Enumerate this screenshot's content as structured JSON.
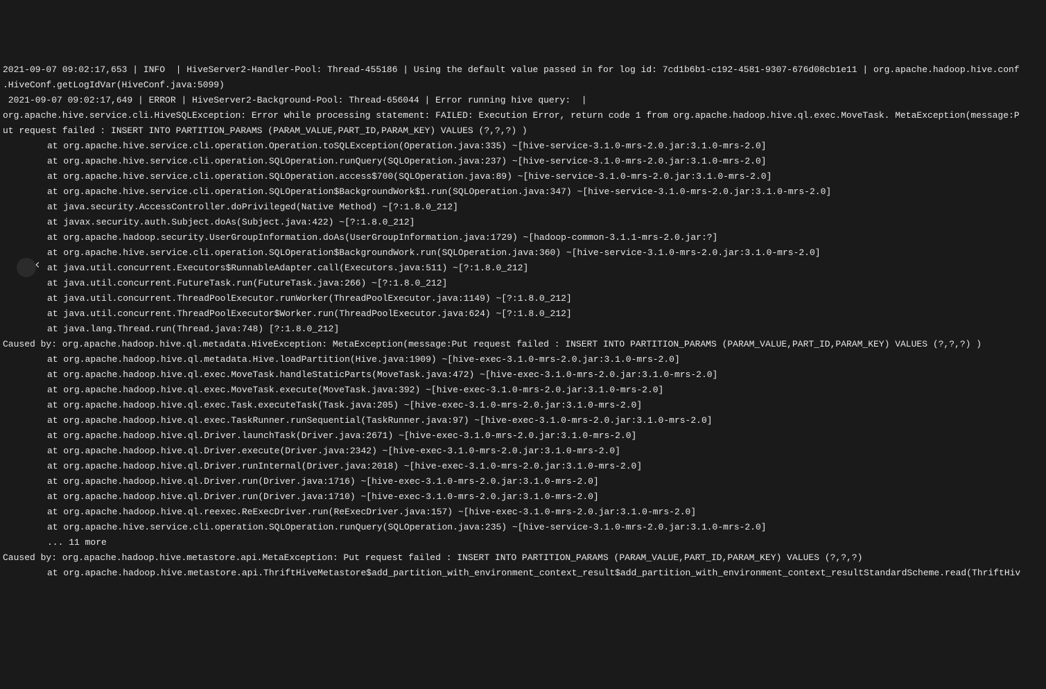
{
  "log": {
    "lines": [
      {
        "indent": false,
        "text": "2021-09-07 09:02:17,653 | INFO  | HiveServer2-Handler-Pool: Thread-455186 | Using the default value passed in for log id: 7cd1b6b1-c192-4581-9307-676d08cb1e11 | org.apache.hadoop.hive.conf"
      },
      {
        "indent": false,
        "text": ".HiveConf.getLogIdVar(HiveConf.java:5099)"
      },
      {
        "indent": false,
        "text": " 2021-09-07 09:02:17,649 | ERROR | HiveServer2-Background-Pool: Thread-656044 | Error running hive query:  |"
      },
      {
        "indent": false,
        "text": "org.apache.hive.service.cli.HiveSQLException: Error while processing statement: FAILED: Execution Error, return code 1 from org.apache.hadoop.hive.ql.exec.MoveTask. MetaException(message:P"
      },
      {
        "indent": false,
        "text": "ut request failed : INSERT INTO PARTITION_PARAMS (PARAM_VALUE,PART_ID,PARAM_KEY) VALUES (?,?,?) )"
      },
      {
        "indent": true,
        "text": "at org.apache.hive.service.cli.operation.Operation.toSQLException(Operation.java:335) ~[hive-service-3.1.0-mrs-2.0.jar:3.1.0-mrs-2.0]"
      },
      {
        "indent": true,
        "text": "at org.apache.hive.service.cli.operation.SQLOperation.runQuery(SQLOperation.java:237) ~[hive-service-3.1.0-mrs-2.0.jar:3.1.0-mrs-2.0]"
      },
      {
        "indent": true,
        "text": "at org.apache.hive.service.cli.operation.SQLOperation.access$700(SQLOperation.java:89) ~[hive-service-3.1.0-mrs-2.0.jar:3.1.0-mrs-2.0]"
      },
      {
        "indent": true,
        "text": "at org.apache.hive.service.cli.operation.SQLOperation$BackgroundWork$1.run(SQLOperation.java:347) ~[hive-service-3.1.0-mrs-2.0.jar:3.1.0-mrs-2.0]"
      },
      {
        "indent": true,
        "text": "at java.security.AccessController.doPrivileged(Native Method) ~[?:1.8.0_212]"
      },
      {
        "indent": true,
        "text": "at javax.security.auth.Subject.doAs(Subject.java:422) ~[?:1.8.0_212]"
      },
      {
        "indent": true,
        "text": "at org.apache.hadoop.security.UserGroupInformation.doAs(UserGroupInformation.java:1729) ~[hadoop-common-3.1.1-mrs-2.0.jar:?]"
      },
      {
        "indent": true,
        "text": "at org.apache.hive.service.cli.operation.SQLOperation$BackgroundWork.run(SQLOperation.java:360) ~[hive-service-3.1.0-mrs-2.0.jar:3.1.0-mrs-2.0]"
      },
      {
        "indent": true,
        "text": "at java.util.concurrent.Executors$RunnableAdapter.call(Executors.java:511) ~[?:1.8.0_212]"
      },
      {
        "indent": true,
        "text": "at java.util.concurrent.FutureTask.run(FutureTask.java:266) ~[?:1.8.0_212]"
      },
      {
        "indent": true,
        "text": "at java.util.concurrent.ThreadPoolExecutor.runWorker(ThreadPoolExecutor.java:1149) ~[?:1.8.0_212]"
      },
      {
        "indent": true,
        "text": "at java.util.concurrent.ThreadPoolExecutor$Worker.run(ThreadPoolExecutor.java:624) ~[?:1.8.0_212]"
      },
      {
        "indent": true,
        "text": "at java.lang.Thread.run(Thread.java:748) [?:1.8.0_212]"
      },
      {
        "indent": false,
        "text": "Caused by: org.apache.hadoop.hive.ql.metadata.HiveException: MetaException(message:Put request failed : INSERT INTO PARTITION_PARAMS (PARAM_VALUE,PART_ID,PARAM_KEY) VALUES (?,?,?) )"
      },
      {
        "indent": true,
        "text": "at org.apache.hadoop.hive.ql.metadata.Hive.loadPartition(Hive.java:1909) ~[hive-exec-3.1.0-mrs-2.0.jar:3.1.0-mrs-2.0]"
      },
      {
        "indent": true,
        "text": "at org.apache.hadoop.hive.ql.exec.MoveTask.handleStaticParts(MoveTask.java:472) ~[hive-exec-3.1.0-mrs-2.0.jar:3.1.0-mrs-2.0]"
      },
      {
        "indent": true,
        "text": "at org.apache.hadoop.hive.ql.exec.MoveTask.execute(MoveTask.java:392) ~[hive-exec-3.1.0-mrs-2.0.jar:3.1.0-mrs-2.0]"
      },
      {
        "indent": true,
        "text": "at org.apache.hadoop.hive.ql.exec.Task.executeTask(Task.java:205) ~[hive-exec-3.1.0-mrs-2.0.jar:3.1.0-mrs-2.0]"
      },
      {
        "indent": true,
        "text": "at org.apache.hadoop.hive.ql.exec.TaskRunner.runSequential(TaskRunner.java:97) ~[hive-exec-3.1.0-mrs-2.0.jar:3.1.0-mrs-2.0]"
      },
      {
        "indent": true,
        "text": "at org.apache.hadoop.hive.ql.Driver.launchTask(Driver.java:2671) ~[hive-exec-3.1.0-mrs-2.0.jar:3.1.0-mrs-2.0]"
      },
      {
        "indent": true,
        "text": "at org.apache.hadoop.hive.ql.Driver.execute(Driver.java:2342) ~[hive-exec-3.1.0-mrs-2.0.jar:3.1.0-mrs-2.0]"
      },
      {
        "indent": true,
        "text": "at org.apache.hadoop.hive.ql.Driver.runInternal(Driver.java:2018) ~[hive-exec-3.1.0-mrs-2.0.jar:3.1.0-mrs-2.0]"
      },
      {
        "indent": true,
        "text": "at org.apache.hadoop.hive.ql.Driver.run(Driver.java:1716) ~[hive-exec-3.1.0-mrs-2.0.jar:3.1.0-mrs-2.0]"
      },
      {
        "indent": true,
        "text": "at org.apache.hadoop.hive.ql.Driver.run(Driver.java:1710) ~[hive-exec-3.1.0-mrs-2.0.jar:3.1.0-mrs-2.0]"
      },
      {
        "indent": true,
        "text": "at org.apache.hadoop.hive.ql.reexec.ReExecDriver.run(ReExecDriver.java:157) ~[hive-exec-3.1.0-mrs-2.0.jar:3.1.0-mrs-2.0]"
      },
      {
        "indent": true,
        "text": "at org.apache.hive.service.cli.operation.SQLOperation.runQuery(SQLOperation.java:235) ~[hive-service-3.1.0-mrs-2.0.jar:3.1.0-mrs-2.0]"
      },
      {
        "indent": true,
        "text": "... 11 more"
      },
      {
        "indent": false,
        "text": "Caused by: org.apache.hadoop.hive.metastore.api.MetaException: Put request failed : INSERT INTO PARTITION_PARAMS (PARAM_VALUE,PART_ID,PARAM_KEY) VALUES (?,?,?)"
      },
      {
        "indent": true,
        "text": "at org.apache.hadoop.hive.metastore.api.ThriftHiveMetastore$add_partition_with_environment_context_result$add_partition_with_environment_context_resultStandardScheme.read(ThriftHiv"
      }
    ]
  }
}
